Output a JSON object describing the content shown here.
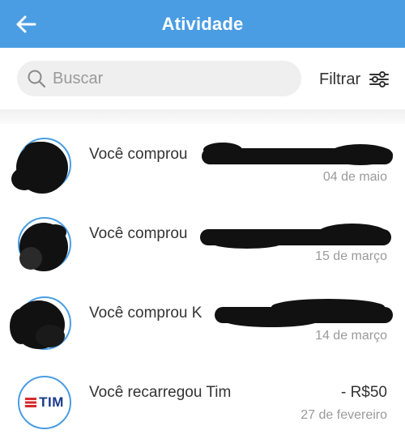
{
  "colors": {
    "accent": "#4a9de3",
    "text": "#333333",
    "muted": "#9a9a9a",
    "tim_red": "#d62a2a",
    "tim_blue": "#1a3a8a"
  },
  "header": {
    "title": "Atividade",
    "back_icon": "arrow-left-icon"
  },
  "search": {
    "placeholder": "Buscar",
    "value": "",
    "icon": "search-icon"
  },
  "filter": {
    "label": "Filtrar",
    "icon": "sliders-icon"
  },
  "activities": [
    {
      "description": "Você comprou",
      "date": "04 de maio",
      "amount": ""
    },
    {
      "description": "Você comprou",
      "date": "15 de março",
      "amount": ""
    },
    {
      "description": "Você comprou K",
      "date": "14 de março",
      "amount": ""
    },
    {
      "description": "Você recarregou Tim",
      "date": "27 de fevereiro",
      "amount": "- R$50",
      "logo_text": "TIM"
    }
  ]
}
